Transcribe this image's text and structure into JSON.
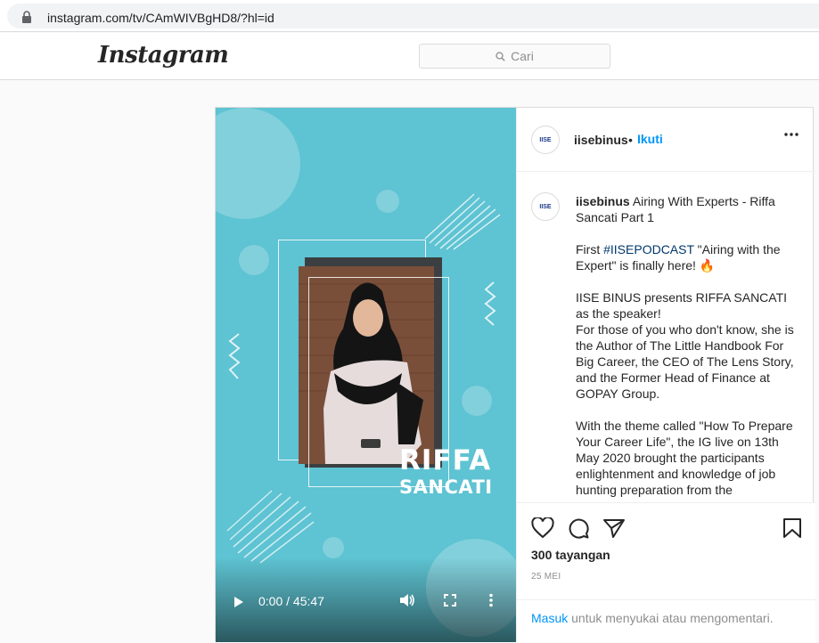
{
  "browser": {
    "url": "instagram.com/tv/CAmWIVBgHD8/?hl=id"
  },
  "header": {
    "logo": "Instagram",
    "search_placeholder": "Cari"
  },
  "video": {
    "name_line1": "RIFFA",
    "name_line2": "SANCATI",
    "time": "0:00 / 45:47"
  },
  "post": {
    "avatar_text": "IISE",
    "username": "iisebinus",
    "separator": "•",
    "follow_label": "Ikuti",
    "caption": {
      "username": "iisebinus",
      "title": "Airing With Experts - Riffa Sancati Part 1",
      "p1_prefix": "First ",
      "p1_hashtag": "#IISEPODCAST",
      "p1_rest": " \"Airing with the Expert\" is finally here! 🔥",
      "p2": "IISE BINUS presents RIFFA SANCATI as the speaker!\nFor those of you who don't know, she is the Author of The Little Handbook For Big Career, the CEO of The Lens Story, and the Former Head of Finance at GOPAY Group.",
      "p3": "With the theme called \"How To Prepare Your Career Life\", the IG live on 13th May 2020 brought the participants enlightenment and knowledge of job hunting preparation from the perspective of"
    },
    "views": "300 tayangan",
    "date": "25 MEI",
    "login_link": "Masuk",
    "login_rest": " untuk menyukai atau mengomentari."
  },
  "colors": {
    "video_bg": "#5ec3d2",
    "link_blue": "#0095f6",
    "hashtag": "#00376b"
  },
  "icons": [
    "lock-icon",
    "search-icon",
    "play-icon",
    "volume-icon",
    "fullscreen-icon",
    "video-more-icon",
    "more-options-icon",
    "heart-icon",
    "comment-icon",
    "share-icon",
    "bookmark-icon"
  ]
}
